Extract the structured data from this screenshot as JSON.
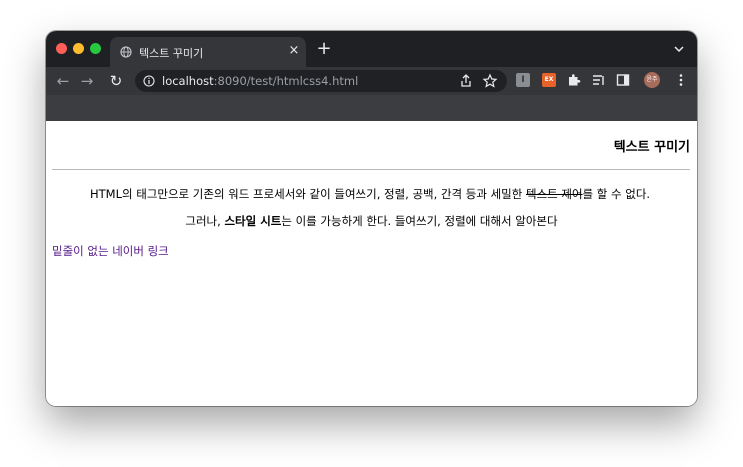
{
  "browser": {
    "tab_title": "텍스트 꾸미기",
    "tab_close": "×",
    "new_tab": "+",
    "url_host": "localhost",
    "url_rest": ":8090/test/htmlcss4.html",
    "profile_initials": "윤주",
    "extension_ex_label": "EX",
    "extension_i_label": "I"
  },
  "page": {
    "heading": "텍스트 꾸미기",
    "p1_before": "HTML의 태그만으로 기존의 워드 프로세서와 같이 들여쓰기, 정렬, 공백, 간격 등과 세밀한 ",
    "p1_strike": "텍스트 제어",
    "p1_after": "를 할 수 없다.",
    "p2_before": "그러나, ",
    "p2_bold": "스타일 시트",
    "p2_after": "는 이를 가능하게 한다. 들여쓰기, 정렬에 대해서 알아본다",
    "link_text": "밑줄이 없는 네이버 링크"
  },
  "colors": {
    "tabstrip": "#1f2023",
    "toolbar": "#35363a",
    "link_visited": "#551a8b"
  }
}
